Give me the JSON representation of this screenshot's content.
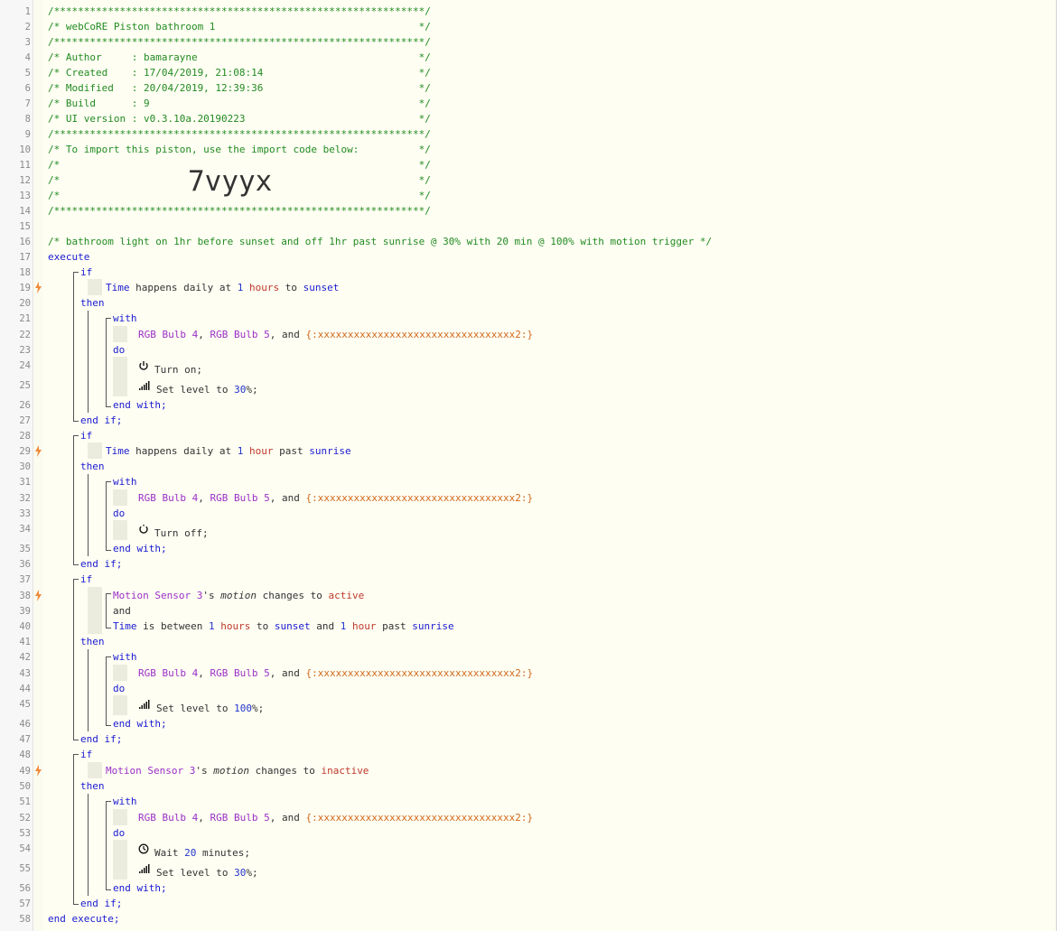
{
  "header": {
    "l1": "/**************************************************************/",
    "l2": "/* webCoRE Piston bathroom 1                                  */",
    "l3": "/**************************************************************/",
    "l4": "/* Author     : bamarayne                                     */",
    "l5": "/* Created    : 17/04/2019, 21:08:14                          */",
    "l6": "/* Modified   : 20/04/2019, 12:39:36                          */",
    "l7": "/* Build      : 9                                             */",
    "l8": "/* UI version : v0.3.10a.20190223                             */",
    "l9": "/**************************************************************/",
    "l10": "/* To import this piston, use the import code below:          */",
    "l11": "/*                                                            */",
    "l12": "/*                                                            */",
    "l13": "/*                                                            */",
    "l14": "/**************************************************************/",
    "import_code": "7vyyx"
  },
  "description": "/* bathroom light on 1hr before sunset and off 1hr past sunrise @ 30% with 20 min @ 100% with motion trigger */",
  "kw": {
    "execute": "execute",
    "end_execute": "end execute;",
    "if": "if",
    "then": "then",
    "with": "with",
    "do": "do",
    "end_with": "end with;",
    "end_if": "end if;",
    "and": "and"
  },
  "devices": {
    "b4": "RGB Bulb 4",
    "b5": "RGB Bulb 5",
    "group": "{:xxxxxxxxxxxxxxxxxxxxxxxxxxxxxxxxx2:}",
    "motion": "Motion Sensor 3",
    "comma": ",",
    "and": "and"
  },
  "conditions": {
    "time": "Time",
    "happens_daily_at": "happens daily at",
    "is_between": "is between",
    "n1": "1",
    "hours": "hours",
    "hour": "hour",
    "to": "to",
    "past": "past",
    "sunset": "sunset",
    "sunrise": "sunrise",
    "s_motion": "'s",
    "motion": "motion",
    "changes_to": "changes to",
    "active": "active",
    "inactive": "inactive",
    "and": "and"
  },
  "actions": {
    "turn_on": "Turn on;",
    "turn_off": "Turn off;",
    "set_level_to": "Set level to",
    "v30": "30",
    "v100": "100",
    "pct_end": "%;",
    "wait": "Wait",
    "v20": "20",
    "minutes_end": "minutes;"
  },
  "icons": {
    "trigger": "lightning-bolt-icon",
    "power_on": "power-icon",
    "power_off": "power-off-icon",
    "level": "signal-bars-icon",
    "wait": "clock-icon"
  },
  "colors": {
    "comment": "#228b22",
    "keyword": "#1a1ad2",
    "device": "#9b30c8",
    "value": "#c0392b",
    "variable": "#d2691e",
    "trigger": "#f08a3a"
  },
  "gutter": [
    "1",
    "2",
    "3",
    "4",
    "5",
    "6",
    "7",
    "8",
    "9",
    "10",
    "11",
    "12",
    "13",
    "14",
    "15",
    "16",
    "17",
    "18",
    "19",
    "20",
    "21",
    "22",
    "23",
    "24",
    "25",
    "26",
    "27",
    "28",
    "29",
    "30",
    "31",
    "32",
    "33",
    "34",
    "35",
    "36",
    "37",
    "38",
    "39",
    "40",
    "41",
    "42",
    "43",
    "44",
    "45",
    "46",
    "47",
    "48",
    "49",
    "50",
    "51",
    "52",
    "53",
    "54",
    "55",
    "56",
    "57",
    "58"
  ]
}
